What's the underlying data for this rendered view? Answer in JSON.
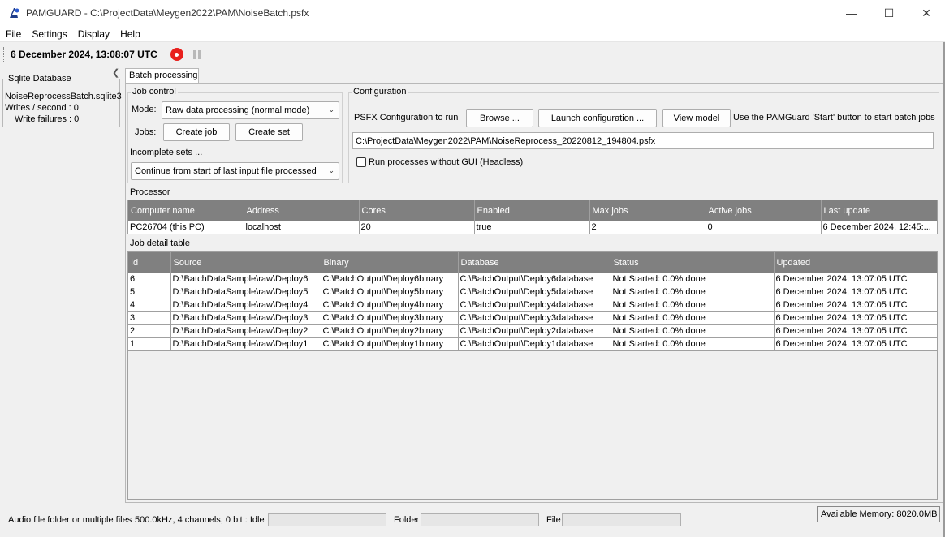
{
  "window": {
    "title": "PAMGUARD - C:\\ProjectData\\Meygen2022\\PAM\\NoiseBatch.psfx",
    "controls": [
      "—",
      "☐",
      "✕"
    ]
  },
  "menu": [
    "File",
    "Settings",
    "Display",
    "Help"
  ],
  "toolbar": {
    "clock": "6 December 2024, 13:08:07 UTC"
  },
  "side_panel": {
    "title": "Sqlite Database",
    "db_name": "NoiseReprocessBatch.sqlite3",
    "writes": "Writes / second : 0",
    "failures": "Write failures : 0"
  },
  "tab": {
    "label": "Batch processing"
  },
  "job_control": {
    "title": "Job control",
    "mode_label": "Mode:",
    "mode_value": "Raw data processing (normal mode)",
    "jobs_label": "Jobs:",
    "create_job": "Create job",
    "create_set": "Create set",
    "incomplete_label": "Incomplete sets ...",
    "incomplete_value": "Continue from start of last input file processed"
  },
  "configuration": {
    "title": "Configuration",
    "psfx_label": "PSFX Configuration to run",
    "browse": "Browse ...",
    "launch": "Launch configuration ...",
    "view_model": "View model",
    "hint": "Use the PAMGuard 'Start' button to start batch jobs",
    "psfx_path": "C:\\ProjectData\\Meygen2022\\PAM\\NoiseReprocess_20220812_194804.psfx",
    "headless_label": "Run processes without GUI (Headless)"
  },
  "processor": {
    "title": "Processor",
    "columns": [
      "Computer name",
      "Address",
      "Cores",
      "Enabled",
      "Max jobs",
      "Active jobs",
      "Last update"
    ],
    "rows": [
      [
        "PC26704 (this PC)",
        "localhost",
        "20",
        "true",
        "2",
        "0",
        "6 December 2024, 12:45:..."
      ]
    ]
  },
  "jobs": {
    "title": "Job detail table",
    "columns": [
      "Id",
      "Source",
      "Binary",
      "Database",
      "Status",
      "Updated"
    ],
    "rows": [
      [
        "6",
        "D:\\BatchDataSample\\raw\\Deploy6",
        "C:\\BatchOutput\\Deploy6binary",
        "C:\\BatchOutput\\Deploy6database",
        "Not Started: 0.0% done",
        "6 December 2024, 13:07:05 UTC"
      ],
      [
        "5",
        "D:\\BatchDataSample\\raw\\Deploy5",
        "C:\\BatchOutput\\Deploy5binary",
        "C:\\BatchOutput\\Deploy5database",
        "Not Started: 0.0% done",
        "6 December 2024, 13:07:05 UTC"
      ],
      [
        "4",
        "D:\\BatchDataSample\\raw\\Deploy4",
        "C:\\BatchOutput\\Deploy4binary",
        "C:\\BatchOutput\\Deploy4database",
        "Not Started: 0.0% done",
        "6 December 2024, 13:07:05 UTC"
      ],
      [
        "3",
        "D:\\BatchDataSample\\raw\\Deploy3",
        "C:\\BatchOutput\\Deploy3binary",
        "C:\\BatchOutput\\Deploy3database",
        "Not Started: 0.0% done",
        "6 December 2024, 13:07:05 UTC"
      ],
      [
        "2",
        "D:\\BatchDataSample\\raw\\Deploy2",
        "C:\\BatchOutput\\Deploy2binary",
        "C:\\BatchOutput\\Deploy2database",
        "Not Started: 0.0% done",
        "6 December 2024, 13:07:05 UTC"
      ],
      [
        "1",
        "D:\\BatchDataSample\\raw\\Deploy1",
        "C:\\BatchOutput\\Deploy1binary",
        "C:\\BatchOutput\\Deploy1database",
        "Not Started: 0.0% done",
        "6 December 2024, 13:07:05 UTC"
      ]
    ]
  },
  "status": {
    "source_label": "Audio file folder or multiple files",
    "source_info": "500.0kHz, 4 channels, 0 bit : Idle",
    "folder_label": "Folder",
    "file_label": "File",
    "memory": "Available Memory: 8020.0MB"
  },
  "colors": {
    "record": "#e8201d",
    "table_header": "#808080"
  }
}
